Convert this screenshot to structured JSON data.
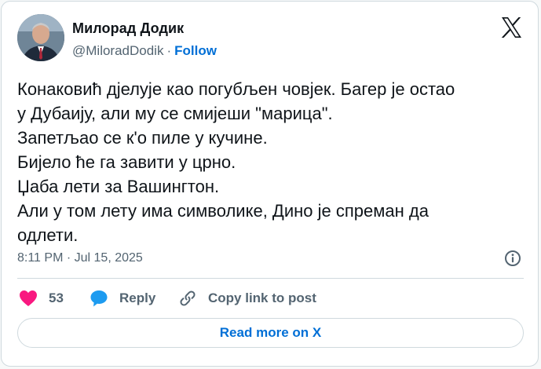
{
  "author": {
    "display_name": "Милорад Додик",
    "handle": "@MiloradDodik",
    "separator": "·",
    "follow_label": "Follow"
  },
  "tweet": {
    "text": "Конаковић дјелује као погубљен човјек. Багер је остао\nу Дубаију, али му се смијеши \"марица\".\nЗапетљао се к'о пиле у кучине.\nБијело ће га завити у црно.\nЏаба лети за Вашингтон.\nАли у том лету има символике, Дино је спреман да\nодлети.",
    "timestamp": "8:11 PM · Jul 15, 2025"
  },
  "actions": {
    "like_count": "53",
    "reply_label": "Reply",
    "copy_link_label": "Copy link to post"
  },
  "footer": {
    "read_more_label": "Read more on X"
  },
  "icons": {
    "logo": "x-logo-icon",
    "info": "info-icon",
    "like": "heart-icon",
    "reply": "speech-bubble-icon",
    "copy": "link-icon"
  },
  "colors": {
    "text": "#0f1419",
    "secondary": "#536471",
    "link": "#006fd6",
    "like": "#f91880",
    "reply": "#1d9bf0",
    "border": "#cfd9de"
  }
}
